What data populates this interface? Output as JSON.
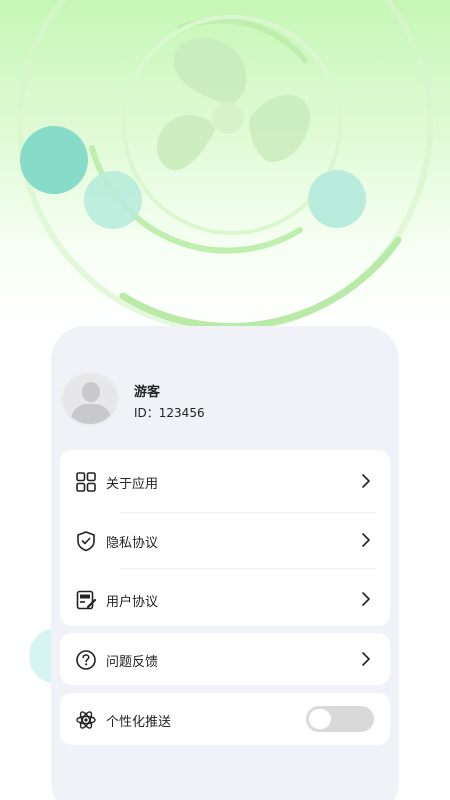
{
  "profile": {
    "name": "游客",
    "id_text": "ID：123456"
  },
  "menu": {
    "items": [
      {
        "label": "关于应用",
        "icon": "grid-apps-icon"
      },
      {
        "label": "隐私协议",
        "icon": "shield-check-icon"
      },
      {
        "label": "用户协议",
        "icon": "document-edit-icon"
      }
    ]
  },
  "feedback": {
    "label": "问题反馈",
    "icon": "question-circle-icon"
  },
  "push": {
    "label": "个性化推送",
    "icon": "atom-icon",
    "enabled": false
  },
  "colors": {
    "hero_top": "#c6f7b6",
    "panel_bg": "#f1f2f8",
    "bubble_teal": "#8be0d0",
    "toggle_off": "#d9d9d9"
  }
}
